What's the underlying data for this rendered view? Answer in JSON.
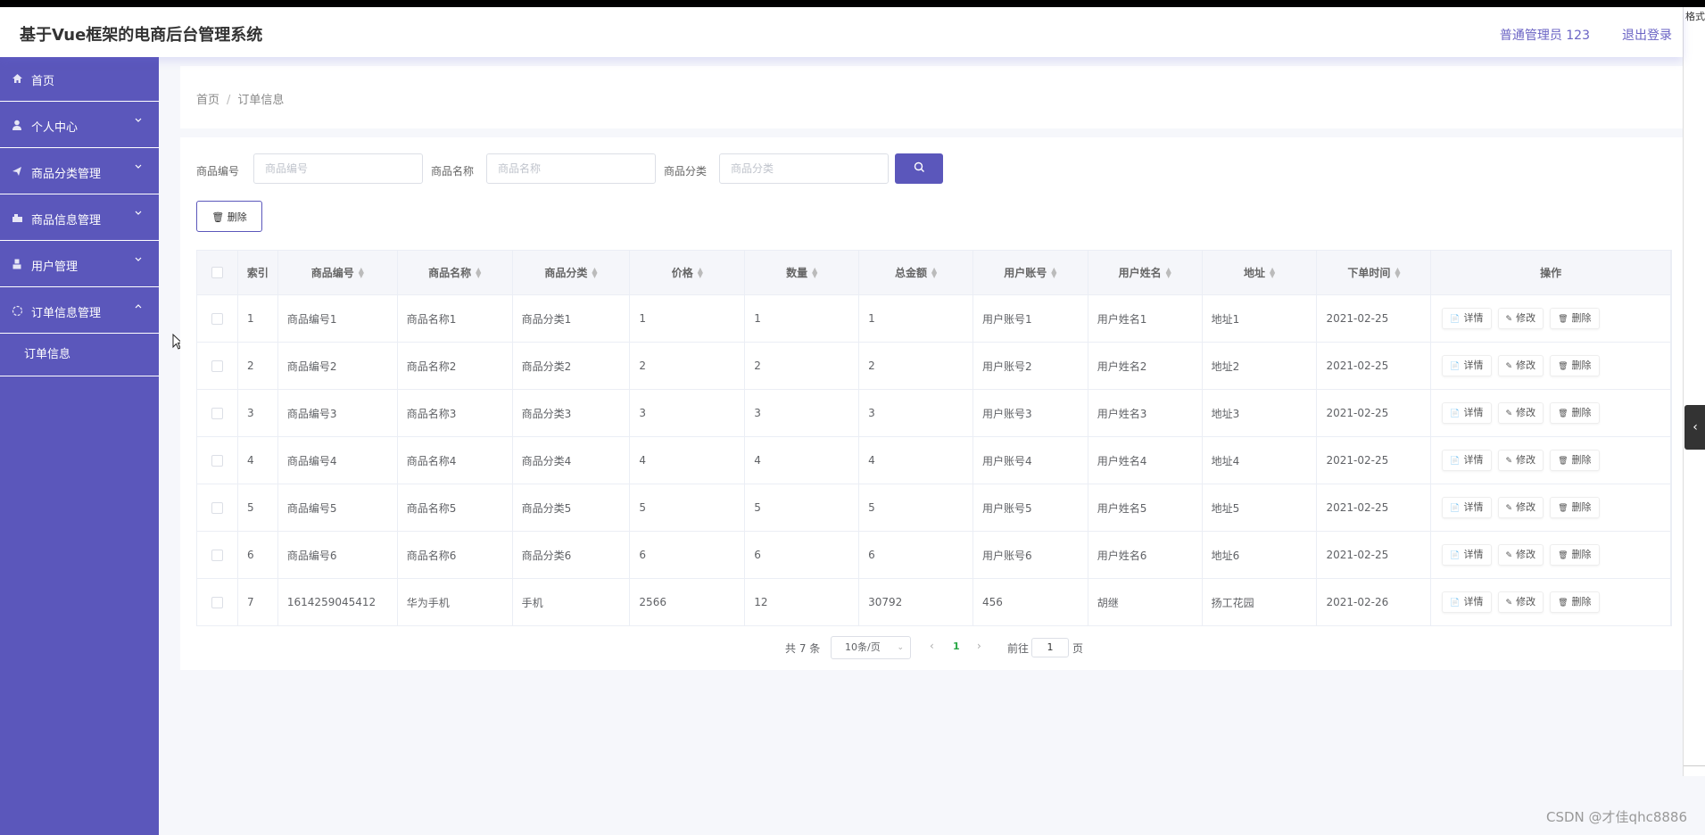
{
  "header": {
    "title": "基于Vue框架的电商后台管理系统",
    "user": "普通管理员 123",
    "logout": "退出登录"
  },
  "right_strip": {
    "tag": "格式刷"
  },
  "sidebar": {
    "items": [
      {
        "label": "首页",
        "icon": "home-icon"
      },
      {
        "label": "个人中心",
        "icon": "user-icon",
        "arrow": "chevron-down-icon"
      },
      {
        "label": "商品分类管理",
        "icon": "send-icon",
        "arrow": "chevron-down-icon"
      },
      {
        "label": "商品信息管理",
        "icon": "goods-icon",
        "arrow": "chevron-down-icon"
      },
      {
        "label": "用户管理",
        "icon": "user-manage-icon",
        "arrow": "chevron-down-icon"
      },
      {
        "label": "订单信息管理",
        "icon": "order-icon",
        "arrow": "chevron-up-icon"
      }
    ],
    "submenu": {
      "label": "订单信息"
    }
  },
  "breadcrumb": {
    "home": "首页",
    "separator": "/",
    "current": "订单信息"
  },
  "search": {
    "code_label": "商品编号",
    "code_placeholder": "商品编号",
    "name_label": "商品名称",
    "name_placeholder": "商品名称",
    "cat_label": "商品分类",
    "cat_placeholder": "商品分类"
  },
  "toolbar": {
    "delete_label": "删除"
  },
  "table": {
    "headers": [
      "索引",
      "商品编号",
      "商品名称",
      "商品分类",
      "价格",
      "数量",
      "总金额",
      "用户账号",
      "用户姓名",
      "地址",
      "下单时间",
      "操作"
    ],
    "rows": [
      [
        "1",
        "商品编号1",
        "商品名称1",
        "商品分类1",
        "1",
        "1",
        "1",
        "用户账号1",
        "用户姓名1",
        "地址1",
        "2021-02-25"
      ],
      [
        "2",
        "商品编号2",
        "商品名称2",
        "商品分类2",
        "2",
        "2",
        "2",
        "用户账号2",
        "用户姓名2",
        "地址2",
        "2021-02-25"
      ],
      [
        "3",
        "商品编号3",
        "商品名称3",
        "商品分类3",
        "3",
        "3",
        "3",
        "用户账号3",
        "用户姓名3",
        "地址3",
        "2021-02-25"
      ],
      [
        "4",
        "商品编号4",
        "商品名称4",
        "商品分类4",
        "4",
        "4",
        "4",
        "用户账号4",
        "用户姓名4",
        "地址4",
        "2021-02-25"
      ],
      [
        "5",
        "商品编号5",
        "商品名称5",
        "商品分类5",
        "5",
        "5",
        "5",
        "用户账号5",
        "用户姓名5",
        "地址5",
        "2021-02-25"
      ],
      [
        "6",
        "商品编号6",
        "商品名称6",
        "商品分类6",
        "6",
        "6",
        "6",
        "用户账号6",
        "用户姓名6",
        "地址6",
        "2021-02-25"
      ],
      [
        "7",
        "1614259045412",
        "华为手机",
        "手机",
        "2566",
        "12",
        "30792",
        "456",
        "胡继",
        "扬工花园",
        "2021-02-26"
      ]
    ],
    "ops": {
      "detail": "详情",
      "edit": "修改",
      "delete": "删除"
    }
  },
  "pagination": {
    "total": "共 7 条",
    "page_size": "10条/页",
    "current_page": "1",
    "goto_prefix": "前往",
    "goto_value": "1",
    "goto_suffix": "页"
  },
  "watermark": "CSDN @才佳qhc8886",
  "colors": {
    "accent": "#5b57bb",
    "page_active": "#28a745"
  }
}
